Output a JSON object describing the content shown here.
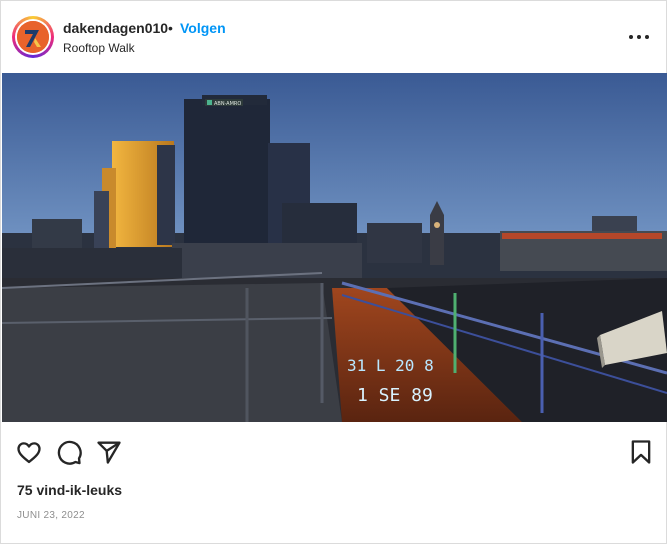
{
  "post": {
    "username": "dakendagen010",
    "separator": "•",
    "follow_label": "Volgen",
    "location": "Rooftop Walk",
    "more_icon": "more-horizontal-icon",
    "likes": "75 vind-ik-leuks",
    "date": "JUNI 23, 2022"
  },
  "photo": {
    "building_sign": "ABN·AMRO",
    "floor_text_line1": "31 L 20 8",
    "floor_text_line2": "1 SE 89"
  },
  "actions": {
    "like_icon": "heart-icon",
    "comment_icon": "comment-icon",
    "share_icon": "send-icon",
    "save_icon": "bookmark-icon"
  },
  "colors": {
    "accent": "#0095f6",
    "text": "#262626",
    "muted": "#8e8e8e",
    "border": "#dbdbdb"
  }
}
